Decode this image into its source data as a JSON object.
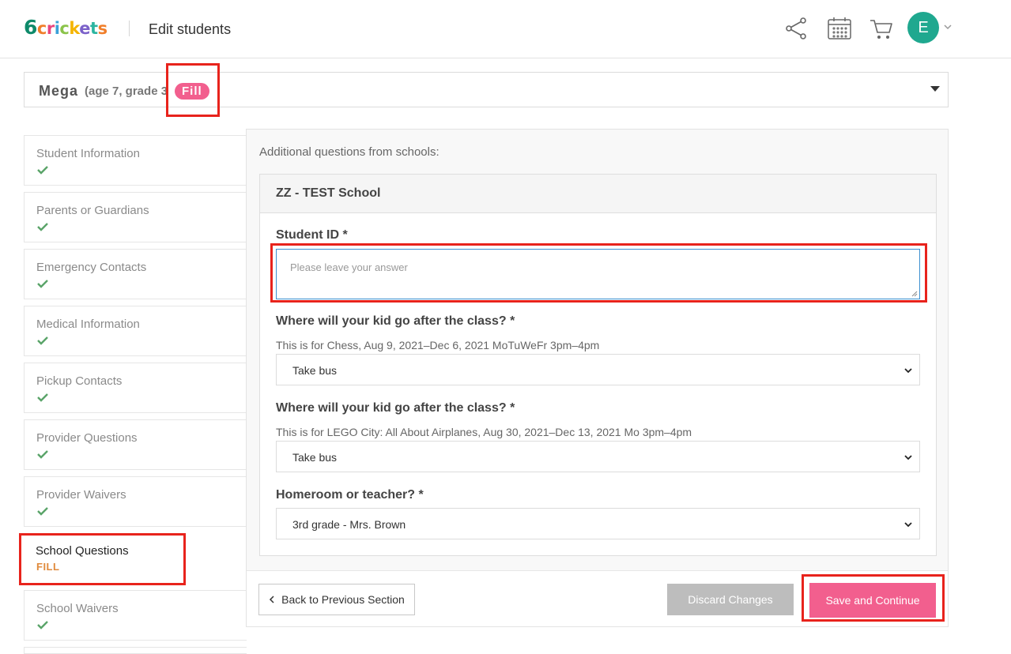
{
  "header": {
    "logo_text": "6crickets",
    "title": "Edit students",
    "icons": [
      "share-icon",
      "calendar-icon",
      "cart-icon"
    ],
    "avatar_initial": "E"
  },
  "student": {
    "name": "Mega",
    "meta": "(age 7, grade 3",
    "badge": "Fill"
  },
  "sidebar": {
    "items": [
      {
        "label": "Student Information",
        "status": "done"
      },
      {
        "label": "Parents or Guardians",
        "status": "done"
      },
      {
        "label": "Emergency Contacts",
        "status": "done"
      },
      {
        "label": "Medical Information",
        "status": "done"
      },
      {
        "label": "Pickup Contacts",
        "status": "done"
      },
      {
        "label": "Provider Questions",
        "status": "done"
      },
      {
        "label": "Provider Waivers",
        "status": "done"
      },
      {
        "label": "School Questions",
        "status": "FILL"
      },
      {
        "label": "School Waivers",
        "status": "done"
      }
    ]
  },
  "main": {
    "intro": "Additional questions from schools:",
    "school_name": "ZZ - TEST School",
    "questions": [
      {
        "label": "Student ID *",
        "placeholder": "Please leave your answer"
      },
      {
        "label": "Where will your kid go after the class? *",
        "sub": "This is for Chess, Aug 9, 2021–Dec 6, 2021 MoTuWeFr 3pm–4pm",
        "value": "Take bus"
      },
      {
        "label": "Where will your kid go after the class? *",
        "sub": "This is for LEGO City: All About Airplanes, Aug 30, 2021–Dec 13, 2021 Mo 3pm–4pm",
        "value": "Take bus"
      },
      {
        "label": "Homeroom or teacher? *",
        "value": "3rd grade - Mrs. Brown"
      }
    ]
  },
  "footer": {
    "back_label": "Back to Previous Section",
    "discard_label": "Discard Changes",
    "save_label": "Save and Continue"
  },
  "colors": {
    "accent_pink": "#f25f8e",
    "teal": "#1fa88f",
    "check_green": "#5aa469",
    "fill_orange": "#e08a3c",
    "highlight_red": "#e8231c"
  }
}
